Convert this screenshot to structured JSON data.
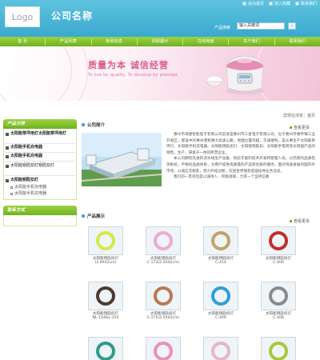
{
  "header": {
    "logo": "Logo",
    "company": "公司名称",
    "links": [
      "设为首页",
      "加入收藏",
      "联系我们"
    ],
    "search_label": "产品搜索",
    "search_value": "输入关键词",
    "search_button": "›"
  },
  "nav": {
    "items": [
      "首 页",
      "产品列表",
      "新闻信息",
      "视频展示",
      "在线询盘",
      "关于我们",
      "联系我们"
    ]
  },
  "banner": {
    "slogan": "质量为本  诚信经营",
    "slogan_en": "To live by quality, To develop by prestige"
  },
  "breadcrumb": "您现在浏览：首页",
  "sidebar": {
    "category_title": "产品分类",
    "categories": [
      {
        "label": "太阳能草坪用灯太阳能草坪用灯",
        "level": "main"
      },
      {
        "label": "太阳能手机充电器",
        "level": "main"
      },
      {
        "label": "太阳能手机充电器",
        "level": "main"
      },
      {
        "label": "太阳能钥匙扣灯钥匙扣灯",
        "level": "main"
      },
      {
        "label": "太阳能钥匙扣灯",
        "level": "main"
      },
      {
        "label": "太阳能手机充电器",
        "level": "sub"
      },
      {
        "label": "太阳能手机充电器",
        "level": "sub"
      }
    ],
    "contact_title": "联系方式"
  },
  "about": {
    "title": "公司简介",
    "more": "查看更多",
    "paragraphs": [
      "惠州市海捷智能电子有限公司前身是惠州市三星电子有限公司，位于惠州市惠环镇工业开发区，建设中的惠州港和惠大高速公路，地理位置优越，交通便利。是从事生产太阳能草坪灯、太阳能手机充电器、太阳能钥匙扣灯、太阳能钥匙扣、太阳能手电筒等太阳能产品的销售，生产，研发于一体的民营企业。",
      "本公司拥有先进的流水线生产设备，经验丰富的技术开发和管理人员，以完善的品质检测系统，严格的品质体系，为用户提供高质量的产品和优质的服务。面对快速发展的国内外市场，以诚信交朋友，努力开拓创新，欢迎各界朋友莅临指导业务洽谈，",
      "我们的一贯宗旨是以诚待人，积极进取，力求一个坚持信赖"
    ]
  },
  "products": {
    "title": "产品展示",
    "more": "查看更多",
    "items": [
      {
        "name": "太阳能钥匙扣灯",
        "model": "(2.0X42cm)",
        "color": "#d7e84a"
      },
      {
        "name": "太阳能钥匙扣灯",
        "model": "C-173(2.5X42cm)",
        "color": "#f0a9d0"
      },
      {
        "name": "太阳能钥匙扣灯",
        "model": "C-414",
        "color": "#c2a36a"
      },
      {
        "name": "太阳能钥匙扣灯",
        "model": "C-400",
        "color": "#c0302e"
      },
      {
        "name": "太阳能钥匙扣灯",
        "model": "NL-154&L-154",
        "color": "#4d3a30"
      },
      {
        "name": "太阳能钥匙扣灯",
        "model": "C-175(2.5X42cm)",
        "color": "#b97a52"
      },
      {
        "name": "太阳能钥匙扣灯",
        "model": "C-409",
        "color": "#2d9fd8"
      },
      {
        "name": "太阳能钥匙扣灯",
        "model": "C-408",
        "color": "#8a8a8a"
      },
      {
        "name": "",
        "model": "",
        "color": "#2e9b8a"
      },
      {
        "name": "",
        "model": "",
        "color": "#e890b8"
      },
      {
        "name": "",
        "model": "",
        "color": "#e8b6c6"
      },
      {
        "name": "",
        "model": "",
        "color": "#a8c83a"
      }
    ]
  },
  "colors": {
    "header_blue": "#3aa9cf",
    "nav_green": "#6fb21f",
    "slogan_pink": "#d85e8e"
  }
}
